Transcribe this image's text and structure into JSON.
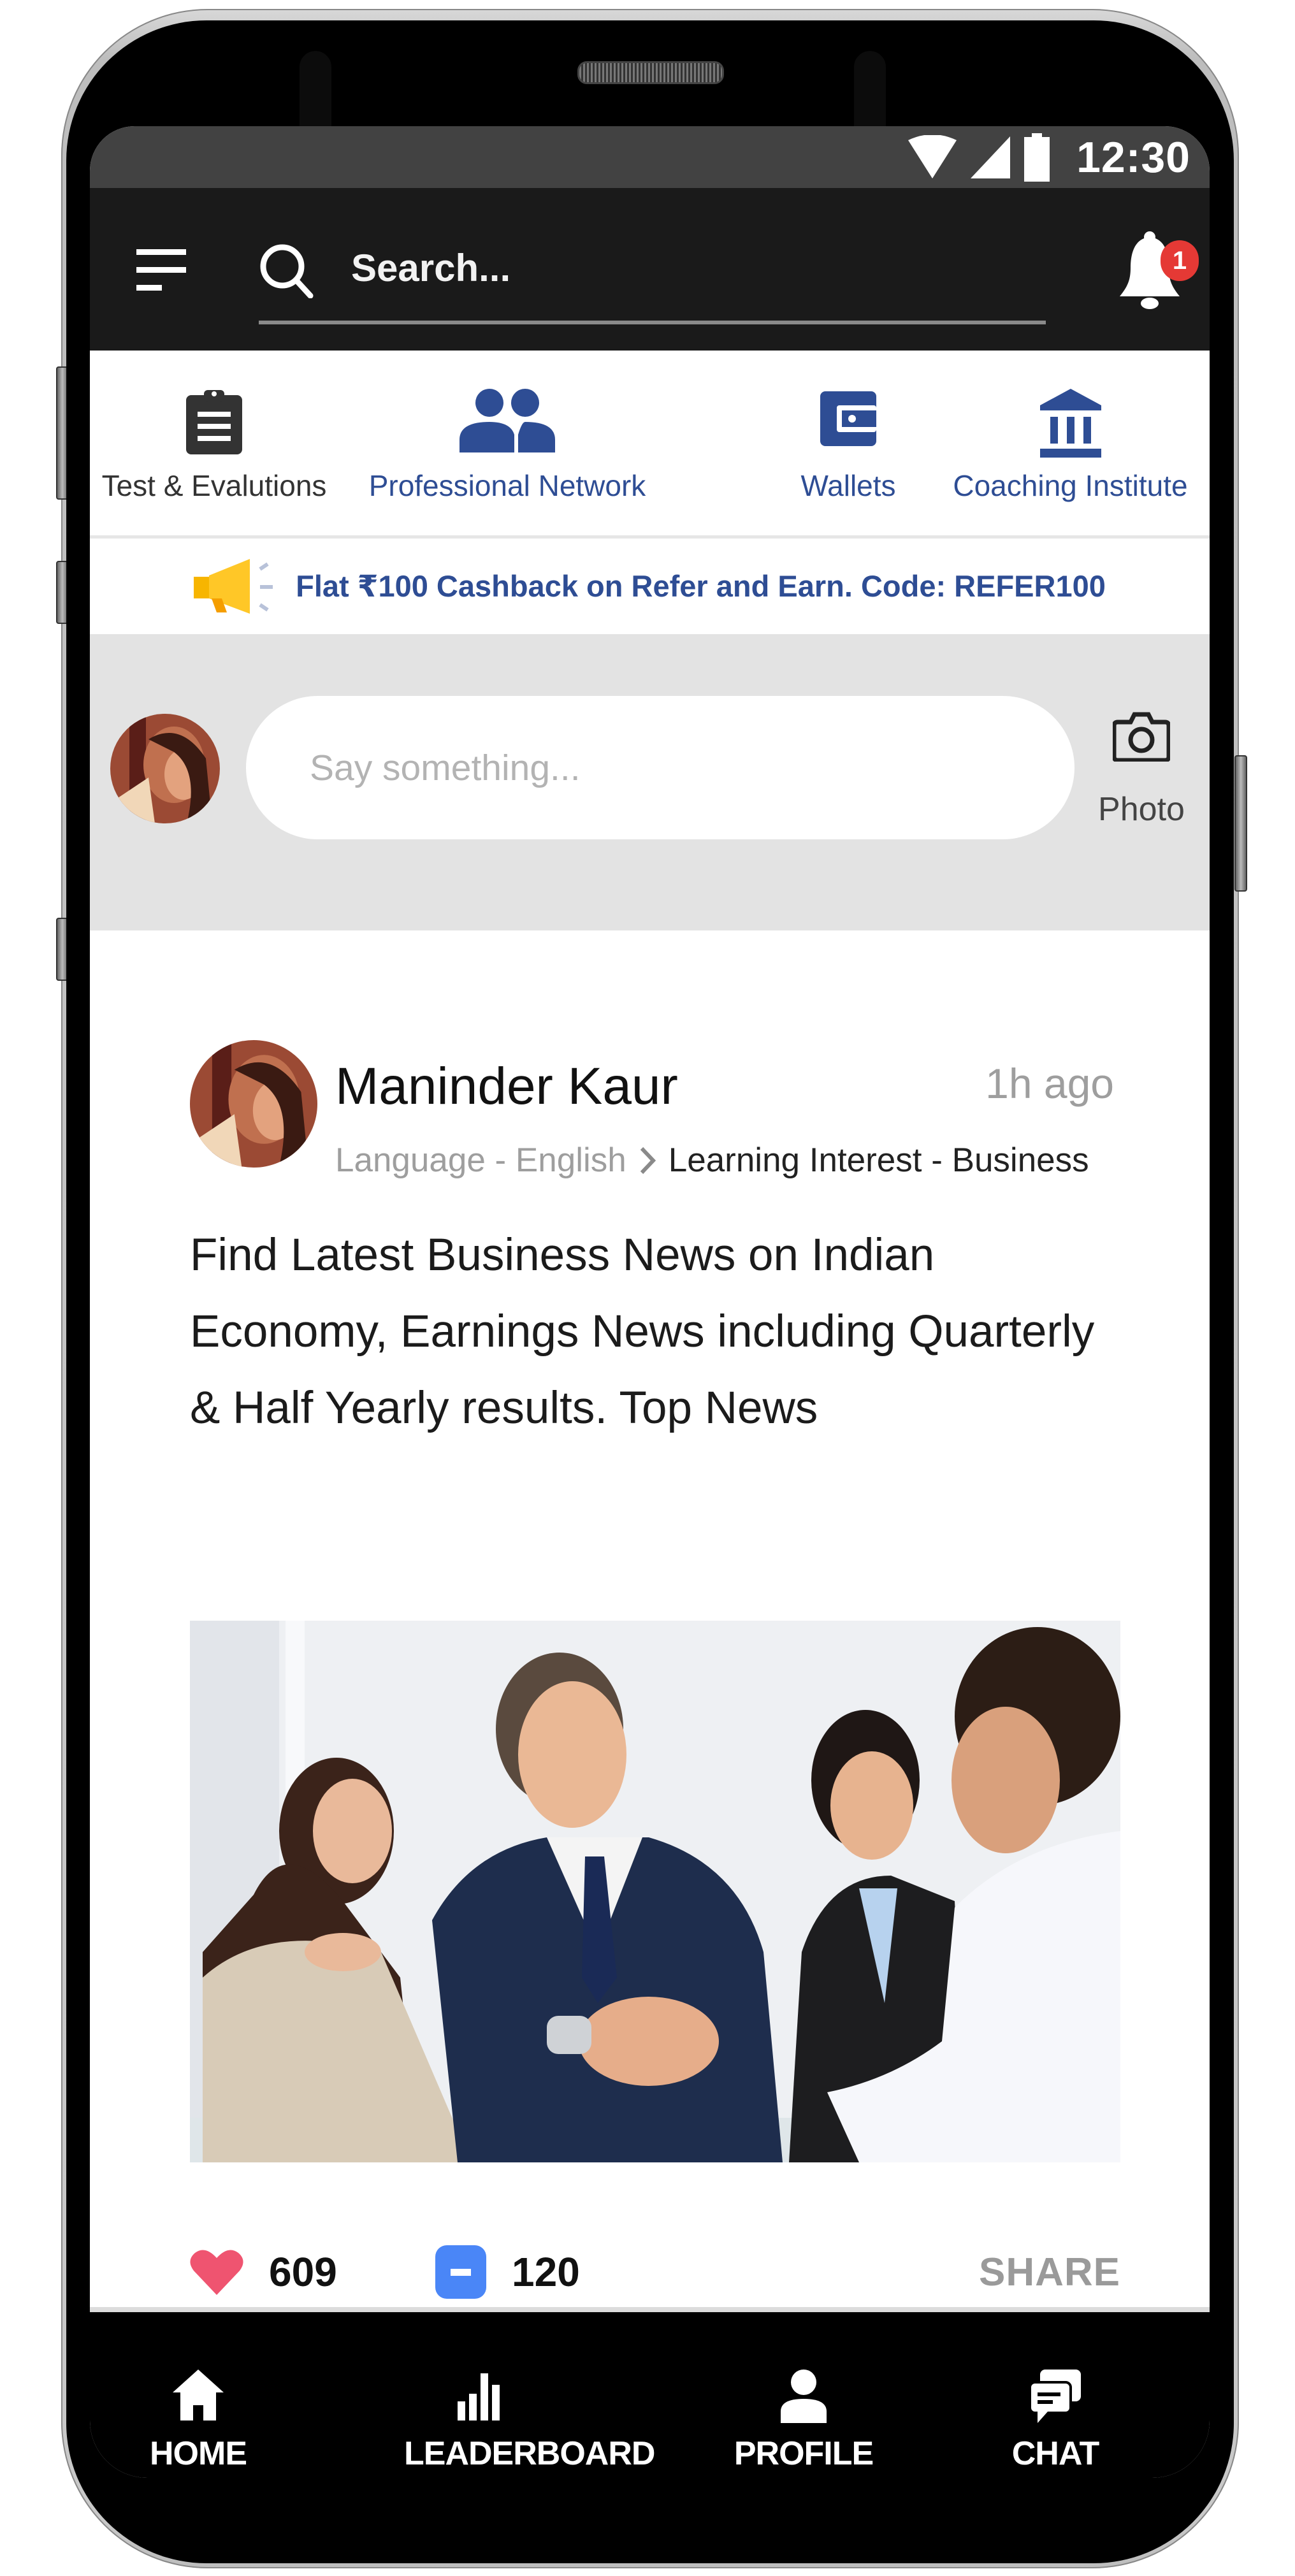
{
  "status_bar": {
    "time": "12:30",
    "icons": [
      "wifi-icon",
      "cell-signal-icon",
      "battery-icon"
    ]
  },
  "header": {
    "menu_icon": "menu-icon",
    "search_placeholder": "Search...",
    "notification_count": "1"
  },
  "categories": [
    {
      "label": "Test & Evalutions",
      "icon": "clipboard-icon",
      "color": "#333333"
    },
    {
      "label": "Professional Network",
      "icon": "people-icon",
      "color": "#2e4d94"
    },
    {
      "label": "Wallets",
      "icon": "wallet-icon",
      "color": "#2e4d94"
    },
    {
      "label": "Coaching Institute",
      "icon": "institution-icon",
      "color": "#2e4d94"
    }
  ],
  "promo": {
    "icon": "megaphone-icon",
    "text": "Flat ₹100 Cashback on Refer and Earn. Code: REFER100"
  },
  "composer": {
    "placeholder": "Say something...",
    "photo_label": "Photo"
  },
  "post": {
    "author": "Maninder Kaur",
    "time": "1h ago",
    "language_tag": "Language - English",
    "interest_tag": "Learning Interest - Business",
    "text": "Find Latest Business News on Indian Economy, Earnings News including Quarterly & Half Yearly results. Top News",
    "image_alt": "Business team shaking hands",
    "likes": "609",
    "comments": "120",
    "share_label": "SHARE"
  },
  "bottom_nav": [
    {
      "label": "HOME",
      "icon": "home-icon"
    },
    {
      "label": "LEADERBOARD",
      "icon": "leaderboard-icon"
    },
    {
      "label": "PROFILE",
      "icon": "profile-icon"
    },
    {
      "label": "CHAT",
      "icon": "chat-icon"
    }
  ],
  "colors": {
    "brand_blue": "#2e4d94",
    "header_bg": "#1a1a1a",
    "status_bg": "#424242",
    "like_red": "#ef5470",
    "comment_blue": "#4a86f7",
    "badge_red": "#e53935",
    "promo_yellow": "#f7b500"
  }
}
